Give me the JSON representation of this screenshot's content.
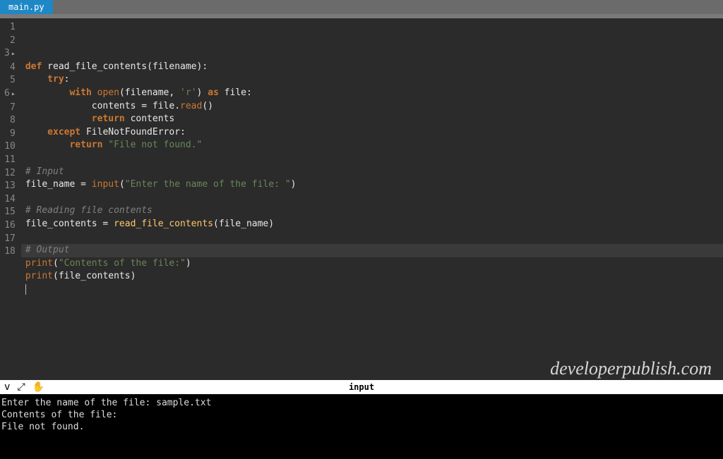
{
  "tab": {
    "filename": "main.py"
  },
  "code": {
    "lines": [
      {
        "n": 1,
        "mark": false,
        "tokens": [
          {
            "c": "kw",
            "t": "def "
          },
          {
            "c": "fn",
            "t": "read_file_contents"
          },
          {
            "c": "paren",
            "t": "("
          },
          {
            "c": "ident",
            "t": "filename"
          },
          {
            "c": "paren",
            "t": ")"
          },
          {
            "c": "punc",
            "t": ":"
          }
        ]
      },
      {
        "n": 2,
        "mark": false,
        "tokens": [
          {
            "c": "kw",
            "t": "    try"
          },
          {
            "c": "punc",
            "t": ":"
          }
        ]
      },
      {
        "n": 3,
        "mark": true,
        "tokens": [
          {
            "c": "",
            "t": "        "
          },
          {
            "c": "kw",
            "t": "with"
          },
          {
            "c": "",
            "t": " "
          },
          {
            "c": "builtin",
            "t": "open"
          },
          {
            "c": "paren",
            "t": "("
          },
          {
            "c": "ident",
            "t": "filename"
          },
          {
            "c": "punc",
            "t": ", "
          },
          {
            "c": "str",
            "t": "'r'"
          },
          {
            "c": "paren",
            "t": ")"
          },
          {
            "c": "",
            "t": " "
          },
          {
            "c": "kw",
            "t": "as"
          },
          {
            "c": "",
            "t": " "
          },
          {
            "c": "ident",
            "t": "file"
          },
          {
            "c": "punc",
            "t": ":"
          }
        ]
      },
      {
        "n": 4,
        "mark": false,
        "tokens": [
          {
            "c": "",
            "t": "            "
          },
          {
            "c": "ident",
            "t": "contents"
          },
          {
            "c": "op",
            "t": " = "
          },
          {
            "c": "ident",
            "t": "file"
          },
          {
            "c": "punc",
            "t": "."
          },
          {
            "c": "attr",
            "t": "read"
          },
          {
            "c": "paren",
            "t": "()"
          }
        ]
      },
      {
        "n": 5,
        "mark": false,
        "tokens": [
          {
            "c": "",
            "t": "            "
          },
          {
            "c": "kw",
            "t": "return"
          },
          {
            "c": "",
            "t": " "
          },
          {
            "c": "ident",
            "t": "contents"
          }
        ]
      },
      {
        "n": 6,
        "mark": true,
        "tokens": [
          {
            "c": "",
            "t": "    "
          },
          {
            "c": "kw",
            "t": "except"
          },
          {
            "c": "",
            "t": " "
          },
          {
            "c": "ident",
            "t": "FileNotFoundError"
          },
          {
            "c": "punc",
            "t": ":"
          }
        ]
      },
      {
        "n": 7,
        "mark": false,
        "tokens": [
          {
            "c": "",
            "t": "        "
          },
          {
            "c": "kw",
            "t": "return"
          },
          {
            "c": "",
            "t": " "
          },
          {
            "c": "str",
            "t": "\"File not found.\""
          }
        ]
      },
      {
        "n": 8,
        "mark": false,
        "tokens": []
      },
      {
        "n": 9,
        "mark": false,
        "tokens": [
          {
            "c": "cmt",
            "t": "# Input"
          }
        ]
      },
      {
        "n": 10,
        "mark": false,
        "tokens": [
          {
            "c": "ident",
            "t": "file_name"
          },
          {
            "c": "op",
            "t": " = "
          },
          {
            "c": "builtin",
            "t": "input"
          },
          {
            "c": "paren",
            "t": "("
          },
          {
            "c": "str",
            "t": "\"Enter the name of the file: \""
          },
          {
            "c": "paren",
            "t": ")"
          }
        ]
      },
      {
        "n": 11,
        "mark": false,
        "tokens": []
      },
      {
        "n": 12,
        "mark": false,
        "tokens": [
          {
            "c": "cmt",
            "t": "# Reading file contents"
          }
        ]
      },
      {
        "n": 13,
        "mark": false,
        "tokens": [
          {
            "c": "ident",
            "t": "file_contents"
          },
          {
            "c": "op",
            "t": " = "
          },
          {
            "c": "call",
            "t": "read_file_contents"
          },
          {
            "c": "paren",
            "t": "("
          },
          {
            "c": "ident",
            "t": "file_name"
          },
          {
            "c": "paren",
            "t": ")"
          }
        ]
      },
      {
        "n": 14,
        "mark": false,
        "tokens": []
      },
      {
        "n": 15,
        "mark": false,
        "tokens": [
          {
            "c": "cmt",
            "t": "# Output"
          }
        ]
      },
      {
        "n": 16,
        "mark": false,
        "tokens": [
          {
            "c": "builtin",
            "t": "print"
          },
          {
            "c": "paren",
            "t": "("
          },
          {
            "c": "str",
            "t": "\"Contents of the file:\""
          },
          {
            "c": "paren",
            "t": ")"
          }
        ]
      },
      {
        "n": 17,
        "mark": false,
        "tokens": [
          {
            "c": "builtin",
            "t": "print"
          },
          {
            "c": "paren",
            "t": "("
          },
          {
            "c": "ident",
            "t": "file_contents"
          },
          {
            "c": "paren",
            "t": ")"
          }
        ]
      },
      {
        "n": 18,
        "mark": false,
        "tokens": []
      }
    ]
  },
  "toolbar": {
    "title": "input",
    "icons": {
      "chevron": "v",
      "expand": "⤢",
      "hand": "✋"
    }
  },
  "console": {
    "lines": [
      "Enter the name of the file: sample.txt",
      "Contents of the file:",
      "File not found."
    ]
  },
  "watermark": "developerpublish.com"
}
